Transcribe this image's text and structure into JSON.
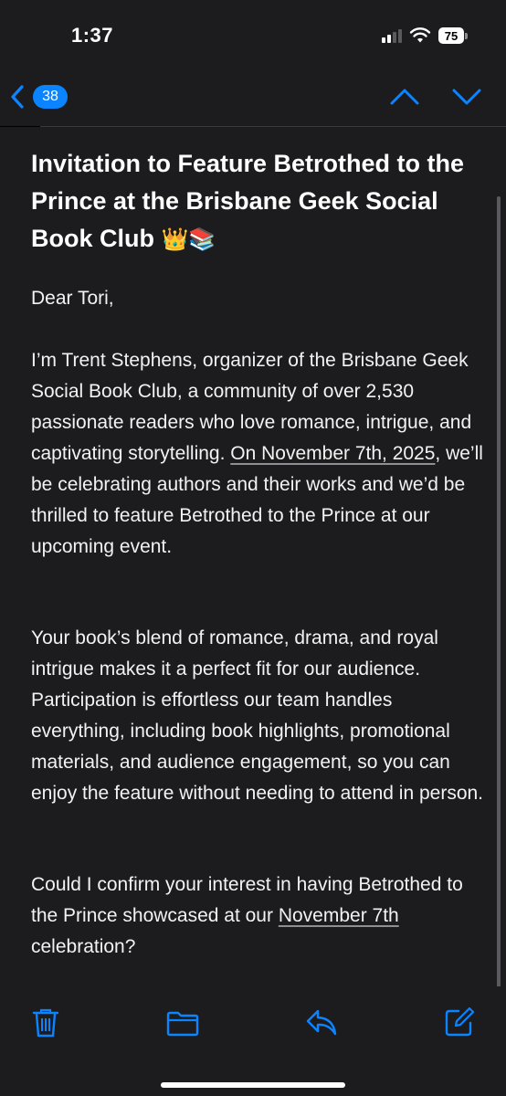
{
  "status_bar": {
    "time": "1:37",
    "battery": "75",
    "icons": [
      "signal-icon",
      "wifi-icon",
      "battery-icon"
    ]
  },
  "nav": {
    "back_badge": "38",
    "icons": [
      "chevron-left-icon",
      "chevron-up-icon",
      "chevron-down-icon"
    ],
    "accent": "#0a84ff"
  },
  "email": {
    "subject": "Invitation to Feature Betrothed to the Prince at the Brisbane Geek Social Book Club",
    "subject_emoji": "👑📚",
    "greeting": "Dear Tori,",
    "p1_before": "I’m Trent Stephens, organizer of the Brisbane Geek Social Book Club, a community of over 2,530 passionate readers who love romance, intrigue, and captivating storytelling. ",
    "p1_link": "On November 7th, 2025",
    "p1_after": ", we’ll be celebrating authors and their works and we’d be thrilled to feature Betrothed to the Prince at our upcoming event.",
    "p2": "Your book’s blend of romance, drama, and royal intrigue makes it a perfect fit for our audience. Participation is effortless our team handles everything, including book highlights, promotional materials, and audience engagement, so you can enjoy the feature without needing to attend in person.",
    "p3_before": "Could I confirm your interest in having Betrothed to the Prince showcased at our ",
    "p3_link": "November 7th",
    "p3_after": " celebration?"
  },
  "toolbar": {
    "icons": [
      "trash-icon",
      "folder-icon",
      "reply-icon",
      "compose-icon"
    ]
  },
  "colors": {
    "background": "#1c1c1e",
    "accent": "#0a84ff",
    "text": "#ffffff"
  }
}
